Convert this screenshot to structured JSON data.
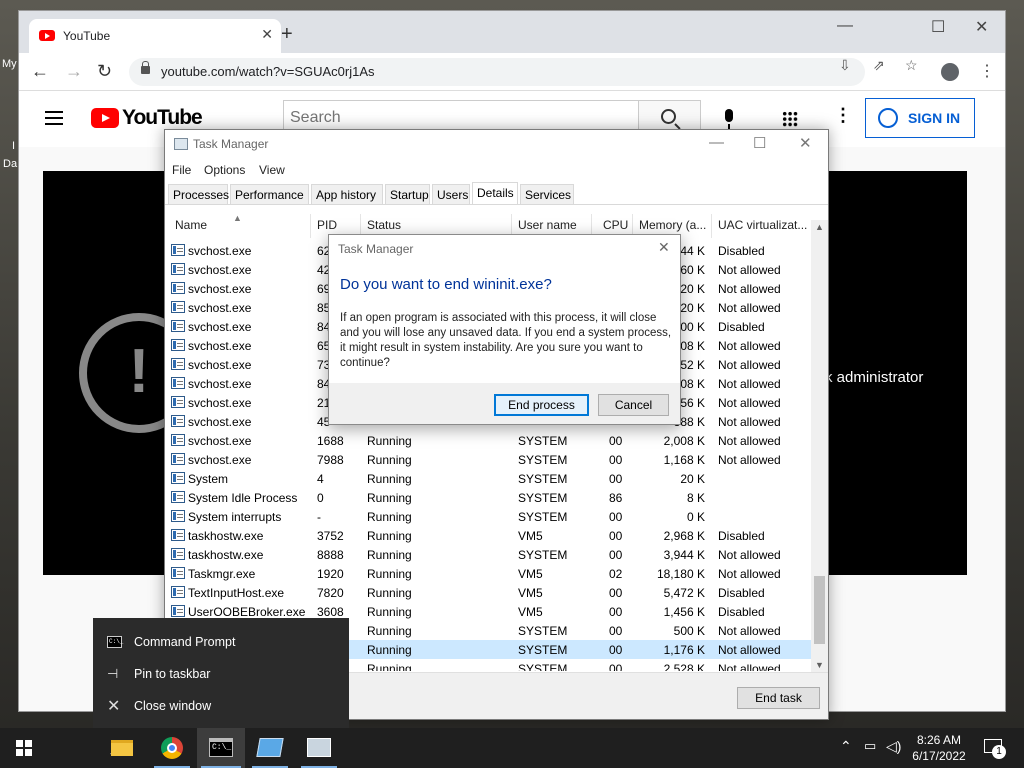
{
  "desktop": {
    "frag_my": "My",
    "frag_da": "Da",
    "frag_i": "I"
  },
  "browser": {
    "tab_title": "YouTube",
    "new_tab": "+",
    "url": "youtube.com/watch?v=SGUAc0rj1As",
    "icons": [
      "back-icon",
      "forward-icon",
      "reload-icon",
      "lock-icon",
      "install-icon",
      "share-icon",
      "bookmark-star-icon",
      "profile-icon",
      "menu-icon"
    ]
  },
  "youtube": {
    "logo_text": "YouTube",
    "search_placeholder": "Search",
    "sign_in": "SIGN IN",
    "error_mark": "!",
    "error_text_fragment": "k administrator"
  },
  "task_manager": {
    "title": "Task Manager",
    "menu": [
      "File",
      "Options",
      "View"
    ],
    "tabs": [
      "Processes",
      "Performance",
      "App history",
      "Startup",
      "Users",
      "Details",
      "Services"
    ],
    "active_tab": "Details",
    "columns": [
      "Name",
      "PID",
      "Status",
      "User name",
      "CPU",
      "Memory (a...",
      "UAC virtualizat..."
    ],
    "rows": [
      {
        "name": "svchost.exe",
        "pid": "62",
        "status": "",
        "user": "",
        "cpu": "",
        "mem": "544 K",
        "uac": "Disabled"
      },
      {
        "name": "svchost.exe",
        "pid": "42",
        "status": "",
        "user": "",
        "cpu": "",
        "mem": "860 K",
        "uac": "Not allowed"
      },
      {
        "name": "svchost.exe",
        "pid": "69",
        "status": "",
        "user": "",
        "cpu": "",
        "mem": "420 K",
        "uac": "Not allowed"
      },
      {
        "name": "svchost.exe",
        "pid": "85",
        "status": "",
        "user": "",
        "cpu": "",
        "mem": "020 K",
        "uac": "Not allowed"
      },
      {
        "name": "svchost.exe",
        "pid": "84",
        "status": "",
        "user": "",
        "cpu": "",
        "mem": "500 K",
        "uac": "Disabled"
      },
      {
        "name": "svchost.exe",
        "pid": "65",
        "status": "",
        "user": "",
        "cpu": "",
        "mem": "408 K",
        "uac": "Not allowed"
      },
      {
        "name": "svchost.exe",
        "pid": "73",
        "status": "",
        "user": "",
        "cpu": "",
        "mem": "352 K",
        "uac": "Not allowed"
      },
      {
        "name": "svchost.exe",
        "pid": "84",
        "status": "",
        "user": "",
        "cpu": "",
        "mem": "808 K",
        "uac": "Not allowed"
      },
      {
        "name": "svchost.exe",
        "pid": "21",
        "status": "",
        "user": "",
        "cpu": "",
        "mem": "256 K",
        "uac": "Not allowed"
      },
      {
        "name": "svchost.exe",
        "pid": "45",
        "status": "",
        "user": "",
        "cpu": "",
        "mem": "388 K",
        "uac": "Not allowed"
      },
      {
        "name": "svchost.exe",
        "pid": "1688",
        "status": "Running",
        "user": "SYSTEM",
        "cpu": "00",
        "mem": "2,008 K",
        "uac": "Not allowed"
      },
      {
        "name": "svchost.exe",
        "pid": "7988",
        "status": "Running",
        "user": "SYSTEM",
        "cpu": "00",
        "mem": "1,168 K",
        "uac": "Not allowed"
      },
      {
        "name": "System",
        "pid": "4",
        "status": "Running",
        "user": "SYSTEM",
        "cpu": "00",
        "mem": "20 K",
        "uac": ""
      },
      {
        "name": "System Idle Process",
        "pid": "0",
        "status": "Running",
        "user": "SYSTEM",
        "cpu": "86",
        "mem": "8 K",
        "uac": ""
      },
      {
        "name": "System interrupts",
        "pid": "-",
        "status": "Running",
        "user": "SYSTEM",
        "cpu": "00",
        "mem": "0 K",
        "uac": ""
      },
      {
        "name": "taskhostw.exe",
        "pid": "3752",
        "status": "Running",
        "user": "VM5",
        "cpu": "00",
        "mem": "2,968 K",
        "uac": "Disabled"
      },
      {
        "name": "taskhostw.exe",
        "pid": "8888",
        "status": "Running",
        "user": "SYSTEM",
        "cpu": "00",
        "mem": "3,944 K",
        "uac": "Not allowed"
      },
      {
        "name": "Taskmgr.exe",
        "pid": "1920",
        "status": "Running",
        "user": "VM5",
        "cpu": "02",
        "mem": "18,180 K",
        "uac": "Not allowed"
      },
      {
        "name": "TextInputHost.exe",
        "pid": "7820",
        "status": "Running",
        "user": "VM5",
        "cpu": "00",
        "mem": "5,472 K",
        "uac": "Disabled"
      },
      {
        "name": "UserOOBEBroker.exe",
        "pid": "3608",
        "status": "Running",
        "user": "VM5",
        "cpu": "00",
        "mem": "1,456 K",
        "uac": "Disabled"
      },
      {
        "name": "",
        "pid": "",
        "status": "Running",
        "user": "SYSTEM",
        "cpu": "00",
        "mem": "500 K",
        "uac": "Not allowed"
      },
      {
        "name": "",
        "pid": "",
        "status": "Running",
        "user": "SYSTEM",
        "cpu": "00",
        "mem": "1,176 K",
        "uac": "Not allowed"
      },
      {
        "name": "",
        "pid": "",
        "status": "Running",
        "user": "SYSTEM",
        "cpu": "00",
        "mem": "2,528 K",
        "uac": "Not allowed"
      }
    ],
    "selected_row": 21,
    "end_task": "End task"
  },
  "dialog": {
    "title": "Task Manager",
    "heading": "Do you want to end wininit.exe?",
    "body": "If an open program is associated with this process, it will close and you will lose any unsaved data. If you end a system process, it might result in system instability. Are you sure you want to continue?",
    "primary": "End process",
    "secondary": "Cancel"
  },
  "jump_list": {
    "items": [
      "Command Prompt",
      "Pin to taskbar",
      "Close window"
    ]
  },
  "taskbar": {
    "time": "8:26 AM",
    "date": "6/17/2022",
    "notification_count": "1",
    "cmd_glyph": "C:\\_"
  },
  "colors": {
    "accent": "#0078d7",
    "youtube_red": "#ff0000",
    "dialog_heading": "#003399",
    "selection": "#cce8ff"
  }
}
